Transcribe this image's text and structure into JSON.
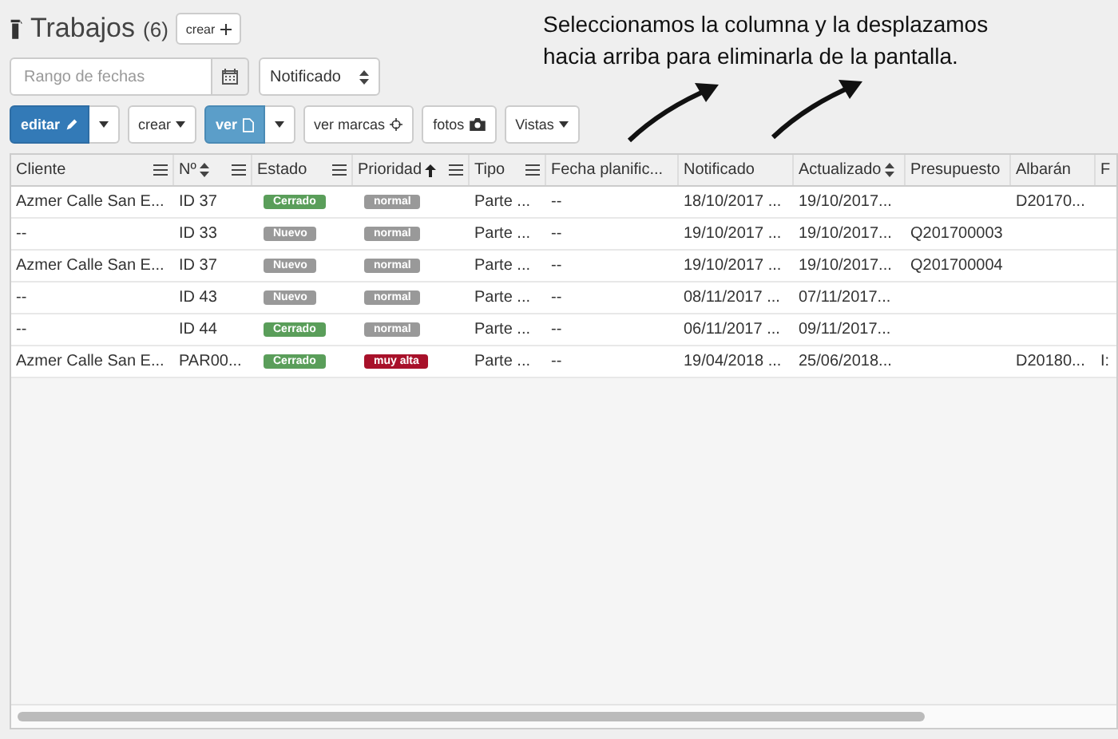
{
  "header": {
    "title": "Trabajos",
    "count": "(6)",
    "create_button": "crear"
  },
  "filters": {
    "date_range": {
      "placeholder": "Rango de fechas"
    },
    "select": {
      "value": "Notificado"
    }
  },
  "toolbar": [
    {
      "kind": "edit",
      "label": "editar"
    },
    {
      "kind": "caret",
      "label": "crear"
    },
    {
      "kind": "view",
      "label": "ver"
    },
    {
      "kind": "marks",
      "label": "ver marcas"
    },
    {
      "kind": "photos",
      "label": "fotos"
    },
    {
      "kind": "caret",
      "label": "Vistas"
    }
  ],
  "annotation": "Seleccionamos la columna y la desplazamos hacia arriba para eliminarla de la pantalla.",
  "table": {
    "columns": [
      {
        "label": "Cliente",
        "menu": true,
        "sortable": false,
        "ascending": false
      },
      {
        "label": "Nº",
        "menu": true,
        "sortable": true,
        "ascending": false
      },
      {
        "label": "Estado",
        "menu": true,
        "sortable": false,
        "ascending": false
      },
      {
        "label": "Prioridad",
        "menu": true,
        "sortable": false,
        "ascending": true
      },
      {
        "label": "Tipo",
        "menu": true,
        "sortable": false,
        "ascending": false
      },
      {
        "label": "Fecha planific...",
        "menu": false,
        "sortable": false,
        "ascending": false
      },
      {
        "label": "Notificado",
        "menu": false,
        "sortable": false,
        "ascending": false
      },
      {
        "label": "Actualizado",
        "menu": false,
        "sortable": true,
        "ascending": false
      },
      {
        "label": "Presupuesto",
        "menu": false,
        "sortable": false,
        "ascending": false
      },
      {
        "label": "Albarán",
        "menu": false,
        "sortable": false,
        "ascending": false
      },
      {
        "label": "F",
        "menu": false,
        "sortable": false,
        "ascending": false
      }
    ],
    "rows": [
      {
        "cells": [
          "Azmer Calle San E...",
          "ID 37",
          {
            "badge": "Cerrado",
            "color": "#5a9e5a"
          },
          {
            "badge": "normal",
            "color": "#999999"
          },
          "Parte ...",
          "--",
          "18/10/2017 ...",
          "19/10/2017...",
          "",
          "D20170...",
          ""
        ]
      },
      {
        "cells": [
          "--",
          "ID 33",
          {
            "badge": "Nuevo",
            "color": "#999999"
          },
          {
            "badge": "normal",
            "color": "#999999"
          },
          "Parte ...",
          "--",
          "19/10/2017 ...",
          "19/10/2017...",
          "Q201700003",
          "",
          ""
        ]
      },
      {
        "cells": [
          "Azmer Calle San E...",
          "ID 37",
          {
            "badge": "Nuevo",
            "color": "#999999"
          },
          {
            "badge": "normal",
            "color": "#999999"
          },
          "Parte ...",
          "--",
          "19/10/2017 ...",
          "19/10/2017...",
          "Q201700004",
          "",
          ""
        ]
      },
      {
        "cells": [
          "--",
          "ID 43",
          {
            "badge": "Nuevo",
            "color": "#999999"
          },
          {
            "badge": "normal",
            "color": "#999999"
          },
          "Parte ...",
          "--",
          "08/11/2017 ...",
          "07/11/2017...",
          "",
          "",
          ""
        ]
      },
      {
        "cells": [
          "--",
          "ID 44",
          {
            "badge": "Cerrado",
            "color": "#5a9e5a"
          },
          {
            "badge": "normal",
            "color": "#999999"
          },
          "Parte ...",
          "--",
          "06/11/2017 ...",
          "09/11/2017...",
          "",
          "",
          ""
        ]
      },
      {
        "cells": [
          "Azmer Calle San E...",
          "PAR00...",
          {
            "badge": "Cerrado",
            "color": "#5a9e5a"
          },
          {
            "badge": "muy alta",
            "color": "#a8112a"
          },
          "Parte ...",
          "--",
          "19/04/2018 ...",
          "25/06/2018...",
          "",
          "D20180...",
          "I:"
        ]
      }
    ]
  }
}
